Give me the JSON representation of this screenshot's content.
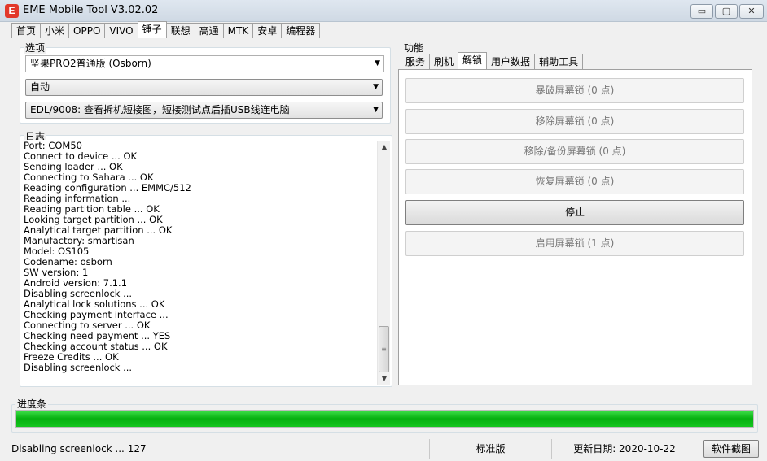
{
  "window": {
    "icon_letter": "E",
    "title": "EME Mobile Tool V3.02.02",
    "btn_min": "▭",
    "btn_max": "▢",
    "btn_close": "✕"
  },
  "main_tabs": [
    "首页",
    "小米",
    "OPPO",
    "VIVO",
    "锤子",
    "联想",
    "高通",
    "MTK",
    "安卓",
    "编程器"
  ],
  "active_main_tab": "锤子",
  "options": {
    "legend": "选项",
    "model_value": "坚果PRO2普通版 (Osborn)",
    "mode_value": "自动",
    "method_value": "EDL/9008: 查看拆机短接图，短接测试点后插USB线连电脑"
  },
  "log": {
    "legend": "日志",
    "lines": [
      "Port: COM50",
      "Connect to device ... OK",
      "Sending loader ... OK",
      "Connecting to Sahara ... OK",
      "Reading configuration ... EMMC/512",
      "Reading information ...",
      "Reading partition table ... OK",
      "Looking target partition ... OK",
      "Analytical target partition ... OK",
      "Manufactory: smartisan",
      "Model: OS105",
      "Codename: osborn",
      "SW version: 1",
      "Android version: 7.1.1",
      "Disabling screenlock ...",
      "Analytical lock solutions ... OK",
      "Checking payment interface ...",
      "Connecting to server ... OK",
      "Checking need payment ... YES",
      "Checking account status ... OK",
      "Freeze Credits ... OK",
      "Disabling screenlock ..."
    ]
  },
  "function": {
    "legend": "功能",
    "tabs": [
      "服务",
      "刷机",
      "解锁",
      "用户数据",
      "辅助工具"
    ],
    "active_tab": "解锁",
    "buttons": [
      {
        "label": "暴破屏幕锁 (0 点)",
        "enabled": false
      },
      {
        "label": "移除屏幕锁 (0 点)",
        "enabled": false
      },
      {
        "label": "移除/备份屏幕锁 (0 点)",
        "enabled": false
      },
      {
        "label": "恢复屏幕锁 (0 点)",
        "enabled": false
      },
      {
        "label": "停止",
        "enabled": true
      },
      {
        "label": "启用屏幕锁 (1 点)",
        "enabled": false
      }
    ]
  },
  "progress": {
    "legend": "进度条",
    "percent": 100
  },
  "status": {
    "message": "Disabling screenlock ... 127",
    "edition": "标准版",
    "update_date": "更新日期: 2020-10-22",
    "screenshot_button": "软件截图"
  },
  "colors": {
    "progress_green": "#06b010",
    "title_bar": "#dfe7f0",
    "app_icon": "#e2382b"
  }
}
